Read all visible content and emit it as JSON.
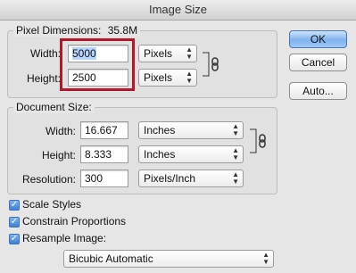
{
  "window": {
    "title": "Image Size"
  },
  "pixel_dimensions": {
    "legend": "Pixel Dimensions:",
    "size": "35.8M",
    "width": {
      "label": "Width:",
      "value": "5000",
      "unit": "Pixels"
    },
    "height": {
      "label": "Height:",
      "value": "2500",
      "unit": "Pixels"
    }
  },
  "document_size": {
    "legend": "Document Size:",
    "width": {
      "label": "Width:",
      "value": "16.667",
      "unit": "Inches"
    },
    "height": {
      "label": "Height:",
      "value": "8.333",
      "unit": "Inches"
    },
    "resolution": {
      "label": "Resolution:",
      "value": "300",
      "unit": "Pixels/Inch"
    }
  },
  "buttons": {
    "ok": "OK",
    "cancel": "Cancel",
    "auto": "Auto..."
  },
  "options": {
    "scale_styles": {
      "label": "Scale Styles",
      "checked": true
    },
    "constrain_proportions": {
      "label": "Constrain Proportions",
      "checked": true
    },
    "resample_image": {
      "label": "Resample Image:",
      "checked": true
    },
    "resample_method": "Bicubic Automatic"
  },
  "colors": {
    "highlight_box": "#b2182b",
    "default_button": "#7fb2ef"
  },
  "icons": {
    "chain_link": "chain-link-icon",
    "checkmark": "checkmark-icon",
    "select_arrows": "select-arrows-icon"
  }
}
